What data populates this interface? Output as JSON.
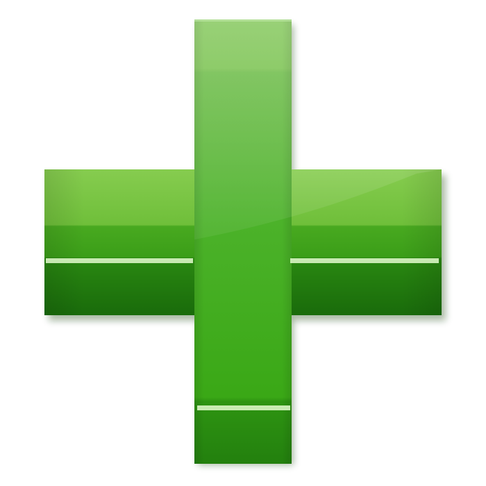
{
  "icon": {
    "name": "plus-icon",
    "colors": {
      "light": "#8fd15a",
      "mid": "#4fb52c",
      "main": "#3aa316",
      "dark": "#217d0d",
      "darkest": "#15620a",
      "highlight": "#d9f5c4"
    }
  }
}
